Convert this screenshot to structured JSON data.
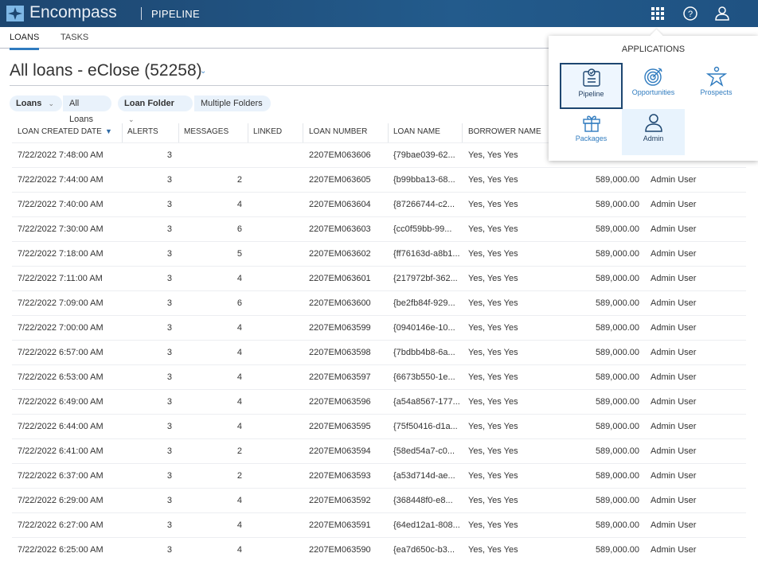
{
  "header": {
    "brand": "Encompass",
    "app": "PIPELINE"
  },
  "tabs": [
    {
      "label": "LOANS",
      "active": true
    },
    {
      "label": "TASKS",
      "active": false
    }
  ],
  "view": {
    "title": "All loans - eClose (52258)"
  },
  "filters": [
    {
      "label": "Loans",
      "value": "All Loans"
    },
    {
      "label": "Loan Folder",
      "value": "Multiple Folders"
    }
  ],
  "columns": [
    "LOAN CREATED DATE",
    "ALERTS",
    "MESSAGES",
    "LINKED",
    "LOAN NUMBER",
    "LOAN NAME",
    "BORROWER NAME"
  ],
  "rows": [
    [
      "7/22/2022 7:48:00 AM",
      "3",
      "",
      "",
      "2207EM063606",
      "{79bae039-62...",
      "Yes, Yes Yes",
      "",
      ""
    ],
    [
      "7/22/2022 7:44:00 AM",
      "3",
      "2",
      "",
      "2207EM063605",
      "{b99bba13-68...",
      "Yes, Yes Yes",
      "589,000.00",
      "Admin User"
    ],
    [
      "7/22/2022 7:40:00 AM",
      "3",
      "4",
      "",
      "2207EM063604",
      "{87266744-c2...",
      "Yes, Yes Yes",
      "589,000.00",
      "Admin User"
    ],
    [
      "7/22/2022 7:30:00 AM",
      "3",
      "6",
      "",
      "2207EM063603",
      "{cc0f59bb-99...",
      "Yes, Yes Yes",
      "589,000.00",
      "Admin User"
    ],
    [
      "7/22/2022 7:18:00 AM",
      "3",
      "5",
      "",
      "2207EM063602",
      "{ff76163d-a8b1...",
      "Yes, Yes Yes",
      "589,000.00",
      "Admin User"
    ],
    [
      "7/22/2022 7:11:00 AM",
      "3",
      "4",
      "",
      "2207EM063601",
      "{217972bf-362...",
      "Yes, Yes Yes",
      "589,000.00",
      "Admin User"
    ],
    [
      "7/22/2022 7:09:00 AM",
      "3",
      "6",
      "",
      "2207EM063600",
      "{be2fb84f-929...",
      "Yes, Yes Yes",
      "589,000.00",
      "Admin User"
    ],
    [
      "7/22/2022 7:00:00 AM",
      "3",
      "4",
      "",
      "2207EM063599",
      "{0940146e-10...",
      "Yes, Yes Yes",
      "589,000.00",
      "Admin User"
    ],
    [
      "7/22/2022 6:57:00 AM",
      "3",
      "4",
      "",
      "2207EM063598",
      "{7bdbb4b8-6a...",
      "Yes, Yes Yes",
      "589,000.00",
      "Admin User"
    ],
    [
      "7/22/2022 6:53:00 AM",
      "3",
      "4",
      "",
      "2207EM063597",
      "{6673b550-1e...",
      "Yes, Yes Yes",
      "589,000.00",
      "Admin User"
    ],
    [
      "7/22/2022 6:49:00 AM",
      "3",
      "4",
      "",
      "2207EM063596",
      "{a54a8567-177...",
      "Yes, Yes Yes",
      "589,000.00",
      "Admin User"
    ],
    [
      "7/22/2022 6:44:00 AM",
      "3",
      "4",
      "",
      "2207EM063595",
      "{75f50416-d1a...",
      "Yes, Yes Yes",
      "589,000.00",
      "Admin User"
    ],
    [
      "7/22/2022 6:41:00 AM",
      "3",
      "2",
      "",
      "2207EM063594",
      "{58ed54a7-c0...",
      "Yes, Yes Yes",
      "589,000.00",
      "Admin User"
    ],
    [
      "7/22/2022 6:37:00 AM",
      "3",
      "2",
      "",
      "2207EM063593",
      "{a53d714d-ae...",
      "Yes, Yes Yes",
      "589,000.00",
      "Admin User"
    ],
    [
      "7/22/2022 6:29:00 AM",
      "3",
      "4",
      "",
      "2207EM063592",
      "{368448f0-e8...",
      "Yes, Yes Yes",
      "589,000.00",
      "Admin User"
    ],
    [
      "7/22/2022 6:27:00 AM",
      "3",
      "4",
      "",
      "2207EM063591",
      "{64ed12a1-808...",
      "Yes, Yes Yes",
      "589,000.00",
      "Admin User"
    ],
    [
      "7/22/2022 6:25:00 AM",
      "3",
      "4",
      "",
      "2207EM063590",
      "{ea7d650c-b3...",
      "Yes, Yes Yes",
      "589,000.00",
      "Admin User"
    ]
  ],
  "apps_popup": {
    "title": "APPLICATIONS",
    "apps": [
      {
        "label": "Pipeline",
        "icon": "clipboard-check-icon",
        "selected": true
      },
      {
        "label": "Opportunities",
        "icon": "target-icon"
      },
      {
        "label": "Prospects",
        "icon": "star-person-icon"
      },
      {
        "label": "Packages",
        "icon": "gift-icon"
      },
      {
        "label": "Admin",
        "icon": "user-icon",
        "hover": true
      }
    ]
  },
  "colors": {
    "header": "#1d4670",
    "accent": "#2f7bbf",
    "chip": "#e9f2fb"
  }
}
